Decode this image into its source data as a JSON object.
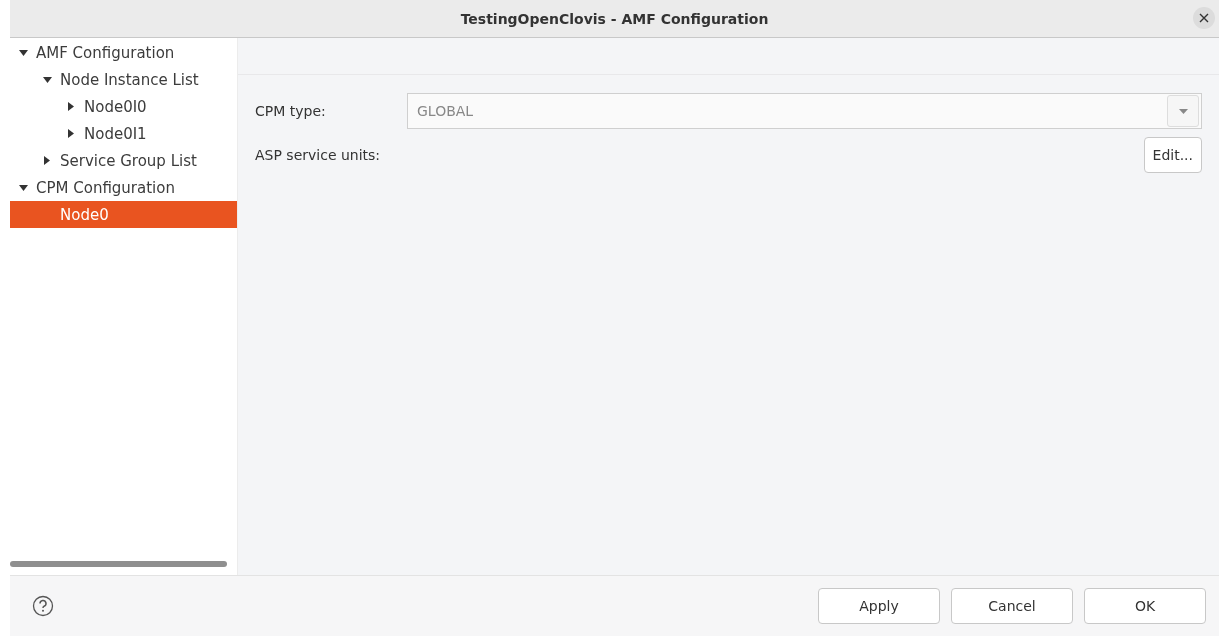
{
  "window": {
    "title": "TestingOpenClovis - AMF Configuration"
  },
  "tree": [
    {
      "label": "AMF Configuration",
      "expanded": true,
      "selected": false,
      "children": [
        {
          "label": "Node Instance List",
          "expanded": true,
          "selected": false,
          "children": [
            {
              "label": "Node0I0",
              "expanded": false,
              "selected": false
            },
            {
              "label": "Node0I1",
              "expanded": false,
              "selected": false
            }
          ]
        },
        {
          "label": "Service Group List",
          "expanded": false,
          "selected": false
        }
      ]
    },
    {
      "label": "CPM Configuration",
      "expanded": true,
      "selected": false,
      "children": [
        {
          "label": "Node0",
          "selected": true
        }
      ]
    }
  ],
  "form": {
    "cpm_type": {
      "label": "CPM type:",
      "value": "GLOBAL",
      "disabled": true
    },
    "asp_service_units": {
      "label": "ASP service units:",
      "button": "Edit..."
    }
  },
  "buttons": [
    "Apply",
    "Cancel",
    "OK"
  ]
}
